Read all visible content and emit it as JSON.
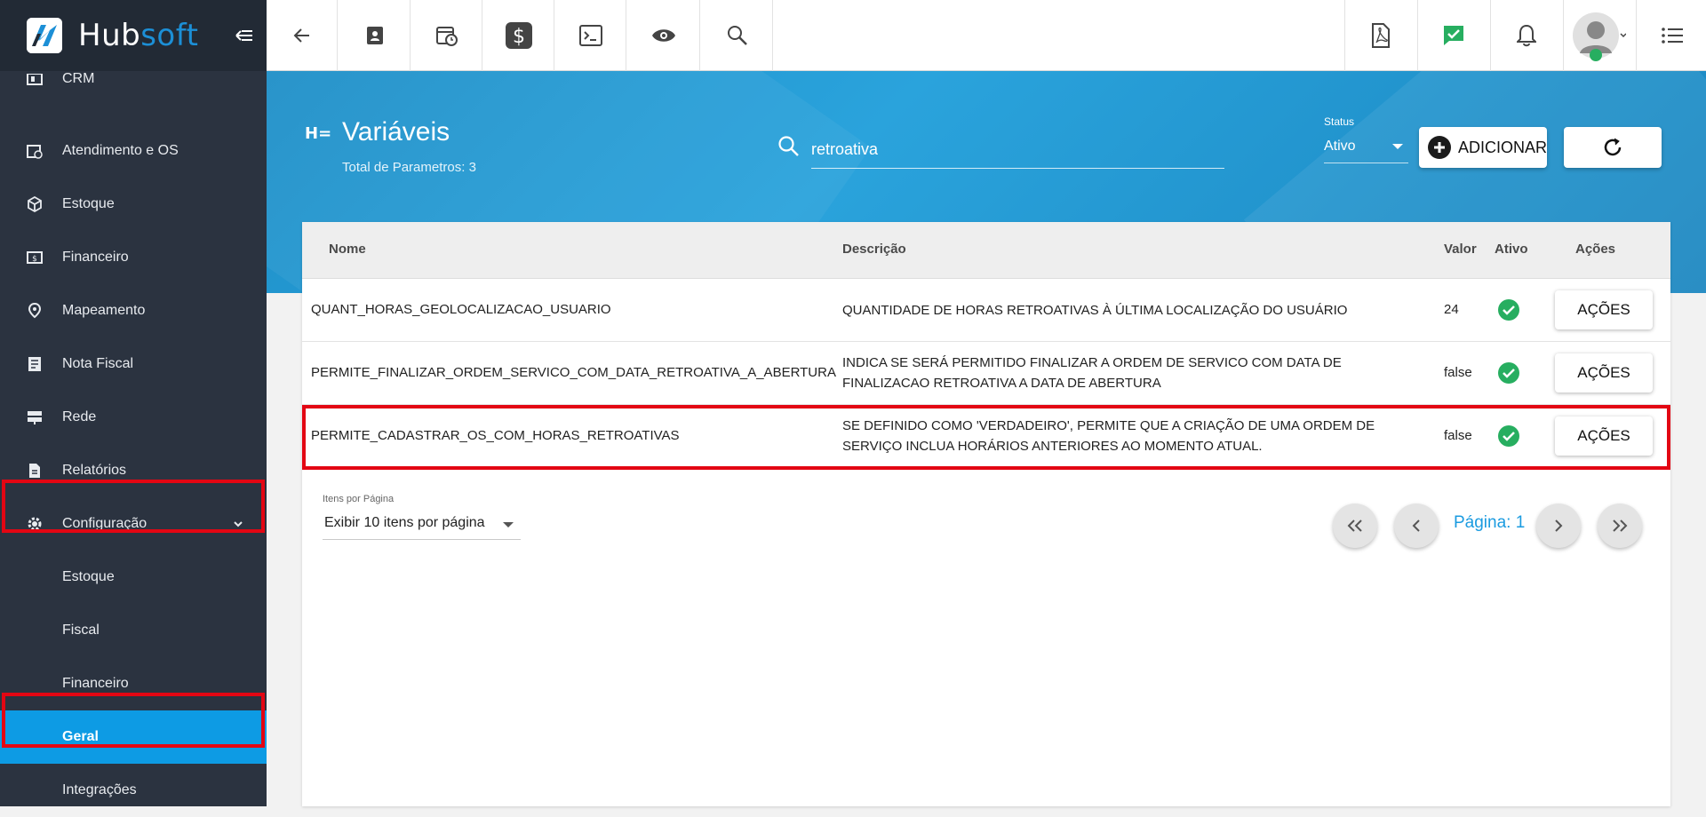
{
  "brand": {
    "name_part1": "Hub",
    "name_part2": "soft"
  },
  "sidebar": {
    "items": [
      {
        "label": "CRM"
      },
      {
        "label": "Atendimento e OS"
      },
      {
        "label": "Estoque"
      },
      {
        "label": "Financeiro"
      },
      {
        "label": "Mapeamento"
      },
      {
        "label": "Nota Fiscal"
      },
      {
        "label": "Rede"
      },
      {
        "label": "Relatórios"
      },
      {
        "label": "Configuração"
      }
    ],
    "sub_items": [
      {
        "label": "Estoque"
      },
      {
        "label": "Fiscal"
      },
      {
        "label": "Financeiro"
      },
      {
        "label": "Geral"
      },
      {
        "label": "Integrações"
      }
    ]
  },
  "header": {
    "title": "Variáveis",
    "subtitle": "Total de Parametros: 3",
    "search_value": "retroativa",
    "status_label": "Status",
    "status_value": "Ativo",
    "add_label": "ADICIONAR"
  },
  "table": {
    "columns": [
      "Nome",
      "Descrição",
      "Valor",
      "Ativo",
      "Ações"
    ],
    "rows": [
      {
        "name": "QUANT_HORAS_GEOLOCALIZACAO_USUARIO",
        "desc": "QUANTIDADE DE HORAS RETROATIVAS À ÚLTIMA LOCALIZAÇÃO DO USUÁRIO",
        "value": "24",
        "action": "AÇÕES"
      },
      {
        "name": "PERMITE_FINALIZAR_ORDEM_SERVICO_COM_DATA_RETROATIVA_A_ABERTURA",
        "desc": "INDICA SE SERÁ PERMITIDO FINALIZAR A ORDEM DE SERVICO COM DATA DE FINALIZACAO RETROATIVA A DATA DE ABERTURA",
        "value": "false",
        "action": "AÇÕES"
      },
      {
        "name": "PERMITE_CADASTRAR_OS_COM_HORAS_RETROATIVAS",
        "desc": "SE DEFINIDO COMO 'VERDADEIRO', PERMITE QUE A CRIAÇÃO DE UMA ORDEM DE SERVIÇO INCLUA HORÁRIOS ANTERIORES AO MOMENTO ATUAL.",
        "value": "false",
        "action": "AÇÕES"
      }
    ]
  },
  "pagination": {
    "items_label": "Itens por Página",
    "items_value": "Exibir 10 itens por página",
    "page_label": "Página: 1"
  },
  "colors": {
    "accent": "#0d9be4",
    "sidebar": "#2b3340",
    "highlight": "#e30613",
    "success": "#27ae60"
  }
}
